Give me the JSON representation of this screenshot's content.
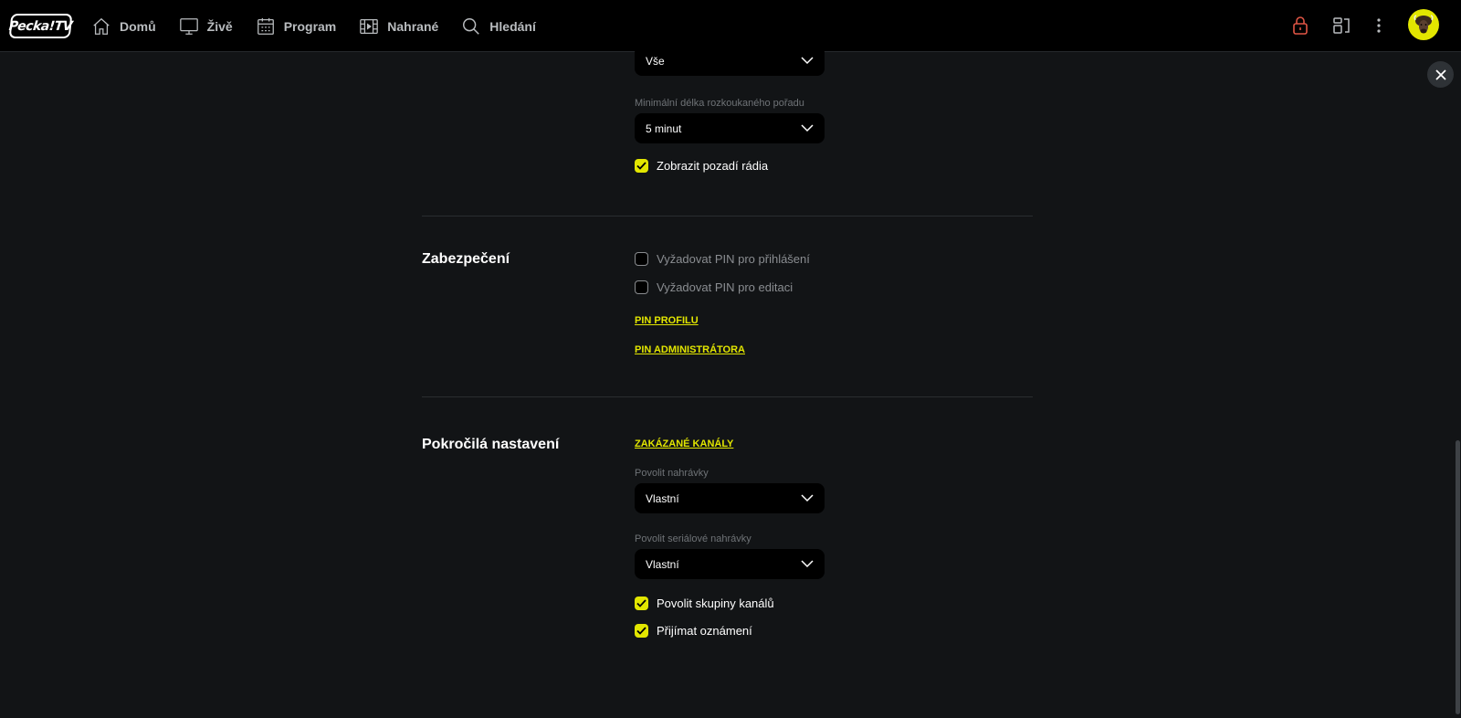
{
  "app": {
    "logo_text": "Pecka!TV"
  },
  "nav": {
    "items": [
      {
        "label": "Domů",
        "icon": "home-icon"
      },
      {
        "label": "Živě",
        "icon": "tv-icon"
      },
      {
        "label": "Program",
        "icon": "calendar-icon"
      },
      {
        "label": "Nahrané",
        "icon": "film-icon"
      },
      {
        "label": "Hledání",
        "icon": "search-icon"
      }
    ]
  },
  "header_icons": [
    "lock-icon",
    "cast-icon",
    "more-vertical-icon",
    "avatar-bison-icon"
  ],
  "colors": {
    "accent": "#e2e600",
    "lock": "#e05545",
    "background": "#121416",
    "topbar": "#000000"
  },
  "settings": {
    "top_select": {
      "value": "Vše"
    },
    "min_length": {
      "label": "Minimální délka rozkoukaného pořadu",
      "value": "5 minut"
    },
    "show_radio_bg": {
      "label": "Zobrazit pozadí rádia",
      "checked": true
    },
    "security": {
      "title": "Zabezpečení",
      "require_pin_login": {
        "label": "Vyžadovat PIN pro přihlášení",
        "checked": false
      },
      "require_pin_edit": {
        "label": "Vyžadovat PIN pro editaci",
        "checked": false
      },
      "profile_pin_link": "PIN PROFILU",
      "admin_pin_link": "PIN ADMINISTRÁTORA"
    },
    "advanced": {
      "title": "Pokročilá nastavení",
      "blocked_channels_link": "ZAKÁZANÉ KANÁLY",
      "allow_recordings": {
        "label": "Povolit nahrávky",
        "value": "Vlastní"
      },
      "allow_series_recordings": {
        "label": "Povolit seriálové nahrávky",
        "value": "Vlastní"
      },
      "allow_channel_groups": {
        "label": "Povolit skupiny kanálů",
        "checked": true
      },
      "receive_notifications": {
        "label": "Přijímat oznámení",
        "checked": true
      }
    }
  }
}
